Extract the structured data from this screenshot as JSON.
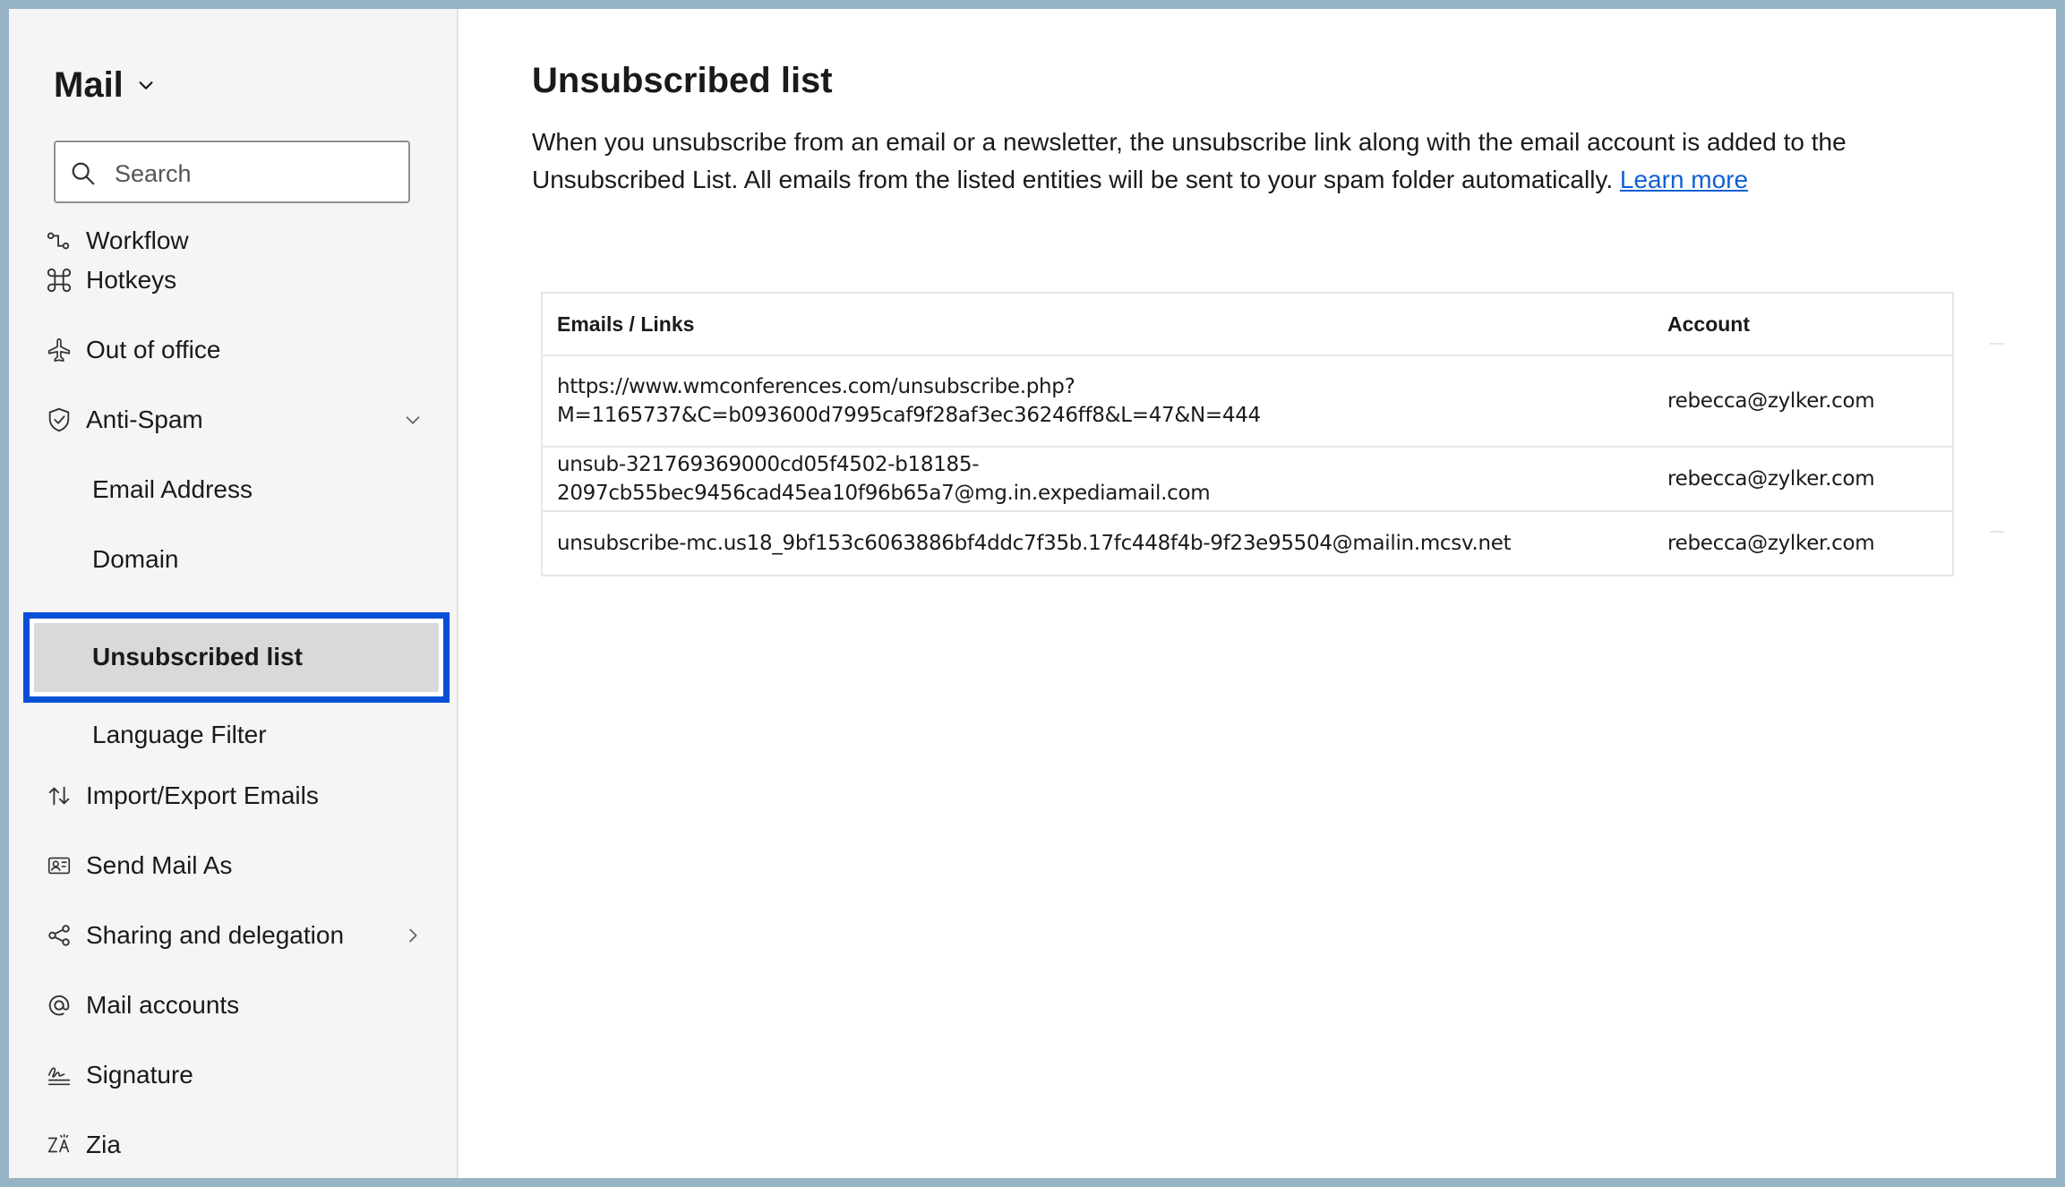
{
  "sidebar": {
    "app_title": "Mail",
    "search_placeholder": "Search",
    "items": [
      {
        "label": "Workflow",
        "icon": "workflow-icon"
      },
      {
        "label": "Hotkeys",
        "icon": "command-icon"
      },
      {
        "label": "Out of office",
        "icon": "airplane-icon"
      },
      {
        "label": "Anti-Spam",
        "icon": "shield-check-icon",
        "expanded": true
      },
      {
        "label": "Email Address"
      },
      {
        "label": "Domain"
      },
      {
        "label": "Unsubscribed list",
        "selected": true
      },
      {
        "label": "Language Filter"
      },
      {
        "label": "Import/Export Emails",
        "icon": "import-export-icon"
      },
      {
        "label": "Send Mail As",
        "icon": "send-as-icon"
      },
      {
        "label": "Sharing and delegation",
        "icon": "share-icon"
      },
      {
        "label": "Mail accounts",
        "icon": "at-icon"
      },
      {
        "label": "Signature",
        "icon": "signature-icon"
      },
      {
        "label": "Zia",
        "icon": "zia-icon"
      }
    ]
  },
  "main": {
    "title": "Unsubscribed list",
    "description": "When you unsubscribe from an email or a newsletter, the unsubscribe link along with the email account is added to the Unsubscribed List. All emails from the listed entities will be sent to your spam folder automatically.",
    "learn_more": "Learn more",
    "table": {
      "headers": [
        "Emails / Links",
        "Account"
      ],
      "rows": [
        {
          "email_line1": "https://www.wmconferences.com/unsubscribe.php?",
          "email_line2": "M=1165737&C=b093600d7995caf9f28af3ec36246ff8&L=47&N=444",
          "account": "rebecca@zylker.com"
        },
        {
          "email_line1": "unsub-321769369000cd05f4502-b18185-2097cb55bec9456cad45ea10f96b65a7@mg.in.expediamail.com",
          "account": "rebecca@zylker.com"
        },
        {
          "email_line1": "unsubscribe-mc.us18_9bf153c6063886bf4ddc7f35b.17fc448f4b-9f23e95504@mailin.mcsv.net",
          "account": "rebecca@zylker.com"
        }
      ]
    }
  },
  "colors": {
    "selection_outline": "#0650d6",
    "link": "#1060d4",
    "selected_bg": "#d9d9dc"
  }
}
